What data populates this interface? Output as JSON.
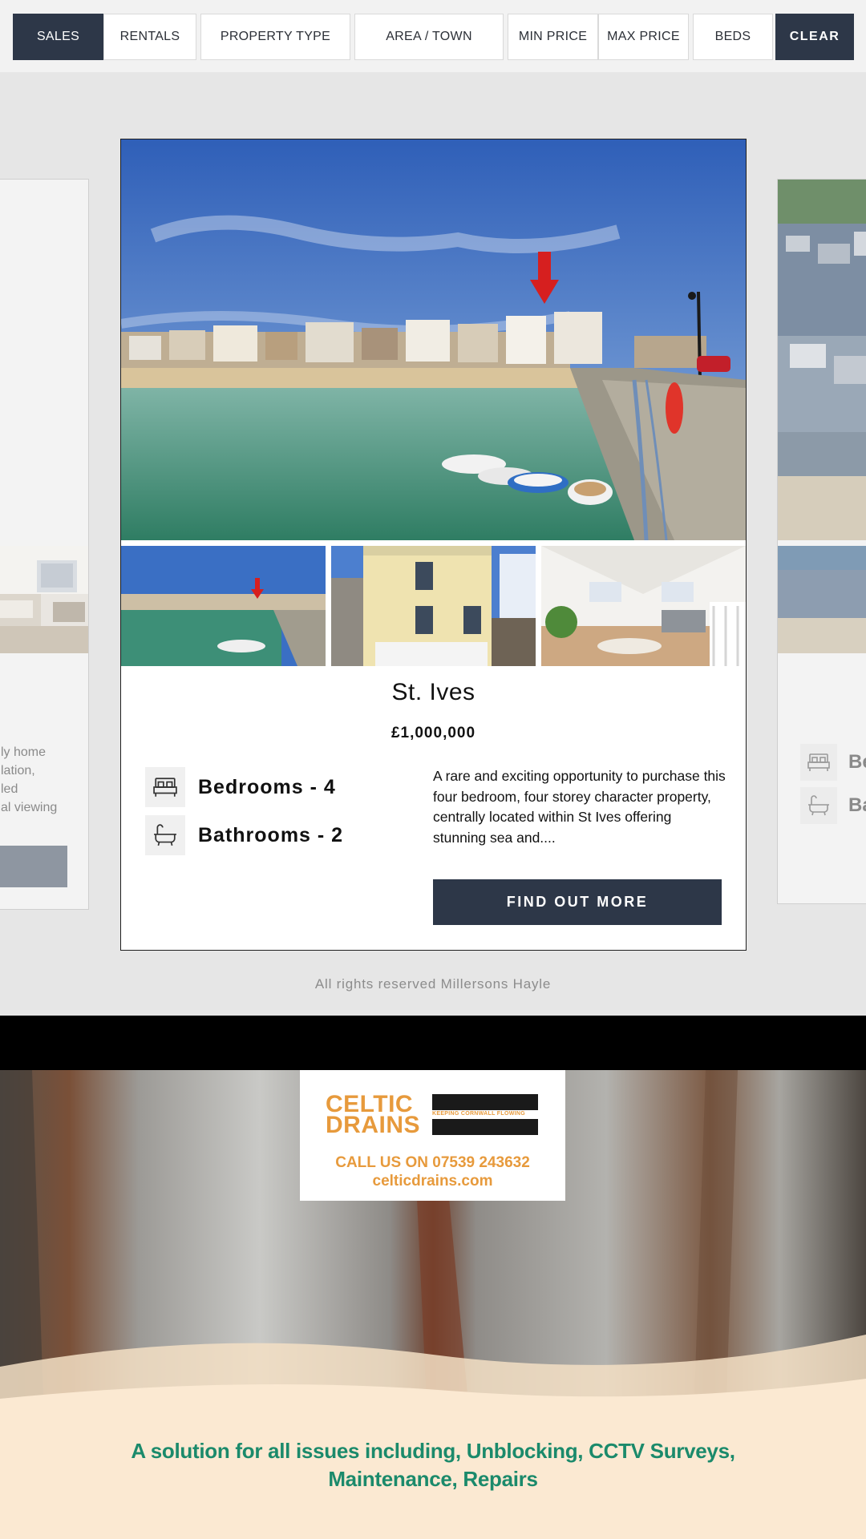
{
  "filters": {
    "sales": "SALES",
    "rentals": "RENTALS",
    "property_type": "PROPERTY TYPE",
    "area_town": "AREA / TOWN",
    "min_price": "MIN PRICE",
    "max_price": "MAX PRICE",
    "beds": "BEDS",
    "clear": "CLEAR"
  },
  "left_card": {
    "desc_lines": [
      "ly home",
      "lation,",
      "led",
      "al viewing"
    ]
  },
  "right_card": {
    "bedrooms_partial": "Be",
    "bathrooms_partial": "Ba"
  },
  "property": {
    "title": "St. Ives",
    "price": "£1,000,000",
    "bedrooms": "Bedrooms - 4",
    "bathrooms": "Bathrooms - 2",
    "description": "A rare and exciting opportunity to purchase this four bedroom, four storey character property, centrally located within St Ives offering stunning sea and....",
    "cta": "FIND OUT MORE"
  },
  "footer": {
    "copyright": "All rights reserved Millersons Hayle"
  },
  "ad": {
    "brand_line1": "CELTIC",
    "brand_line2": "DRAINS",
    "brand_tagline": "KEEPING CORNWALL FLOWING",
    "phone": "CALL US ON 07539 243632",
    "website": "celticdrains.com",
    "tagline_line1": "A solution for all issues including, Unblocking, CCTV Surveys,",
    "tagline_line2": "Maintenance, Repairs"
  },
  "colors": {
    "navy": "#2d3748",
    "brand_orange": "#e79a3c",
    "ad_green": "#1b8a6b"
  }
}
